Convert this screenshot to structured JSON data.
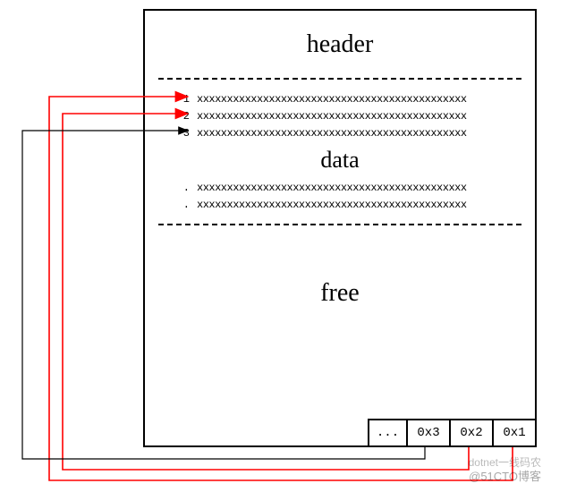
{
  "page": {
    "header_label": "header",
    "data_label": "data",
    "free_label": "free",
    "rows": [
      {
        "num": "1",
        "content": "xxxxxxxxxxxxxxxxxxxxxxxxxxxxxxxxxxxxxxxxxxxxx"
      },
      {
        "num": "2",
        "content": "xxxxxxxxxxxxxxxxxxxxxxxxxxxxxxxxxxxxxxxxxxxxx"
      },
      {
        "num": "3",
        "content": "xxxxxxxxxxxxxxxxxxxxxxxxxxxxxxxxxxxxxxxxxxxxx"
      },
      {
        "num": ".",
        "content": "xxxxxxxxxxxxxxxxxxxxxxxxxxxxxxxxxxxxxxxxxxxxx"
      },
      {
        "num": ".",
        "content": "xxxxxxxxxxxxxxxxxxxxxxxxxxxxxxxxxxxxxxxxxxxxx"
      }
    ],
    "offsets": [
      "...",
      "0x3",
      "0x2",
      "0x1"
    ]
  },
  "watermark": {
    "line1": "dotnet一线码农",
    "line2": "@51CTO博客"
  },
  "colors": {
    "arrow_red": "#ff0000",
    "arrow_black": "#000000"
  }
}
